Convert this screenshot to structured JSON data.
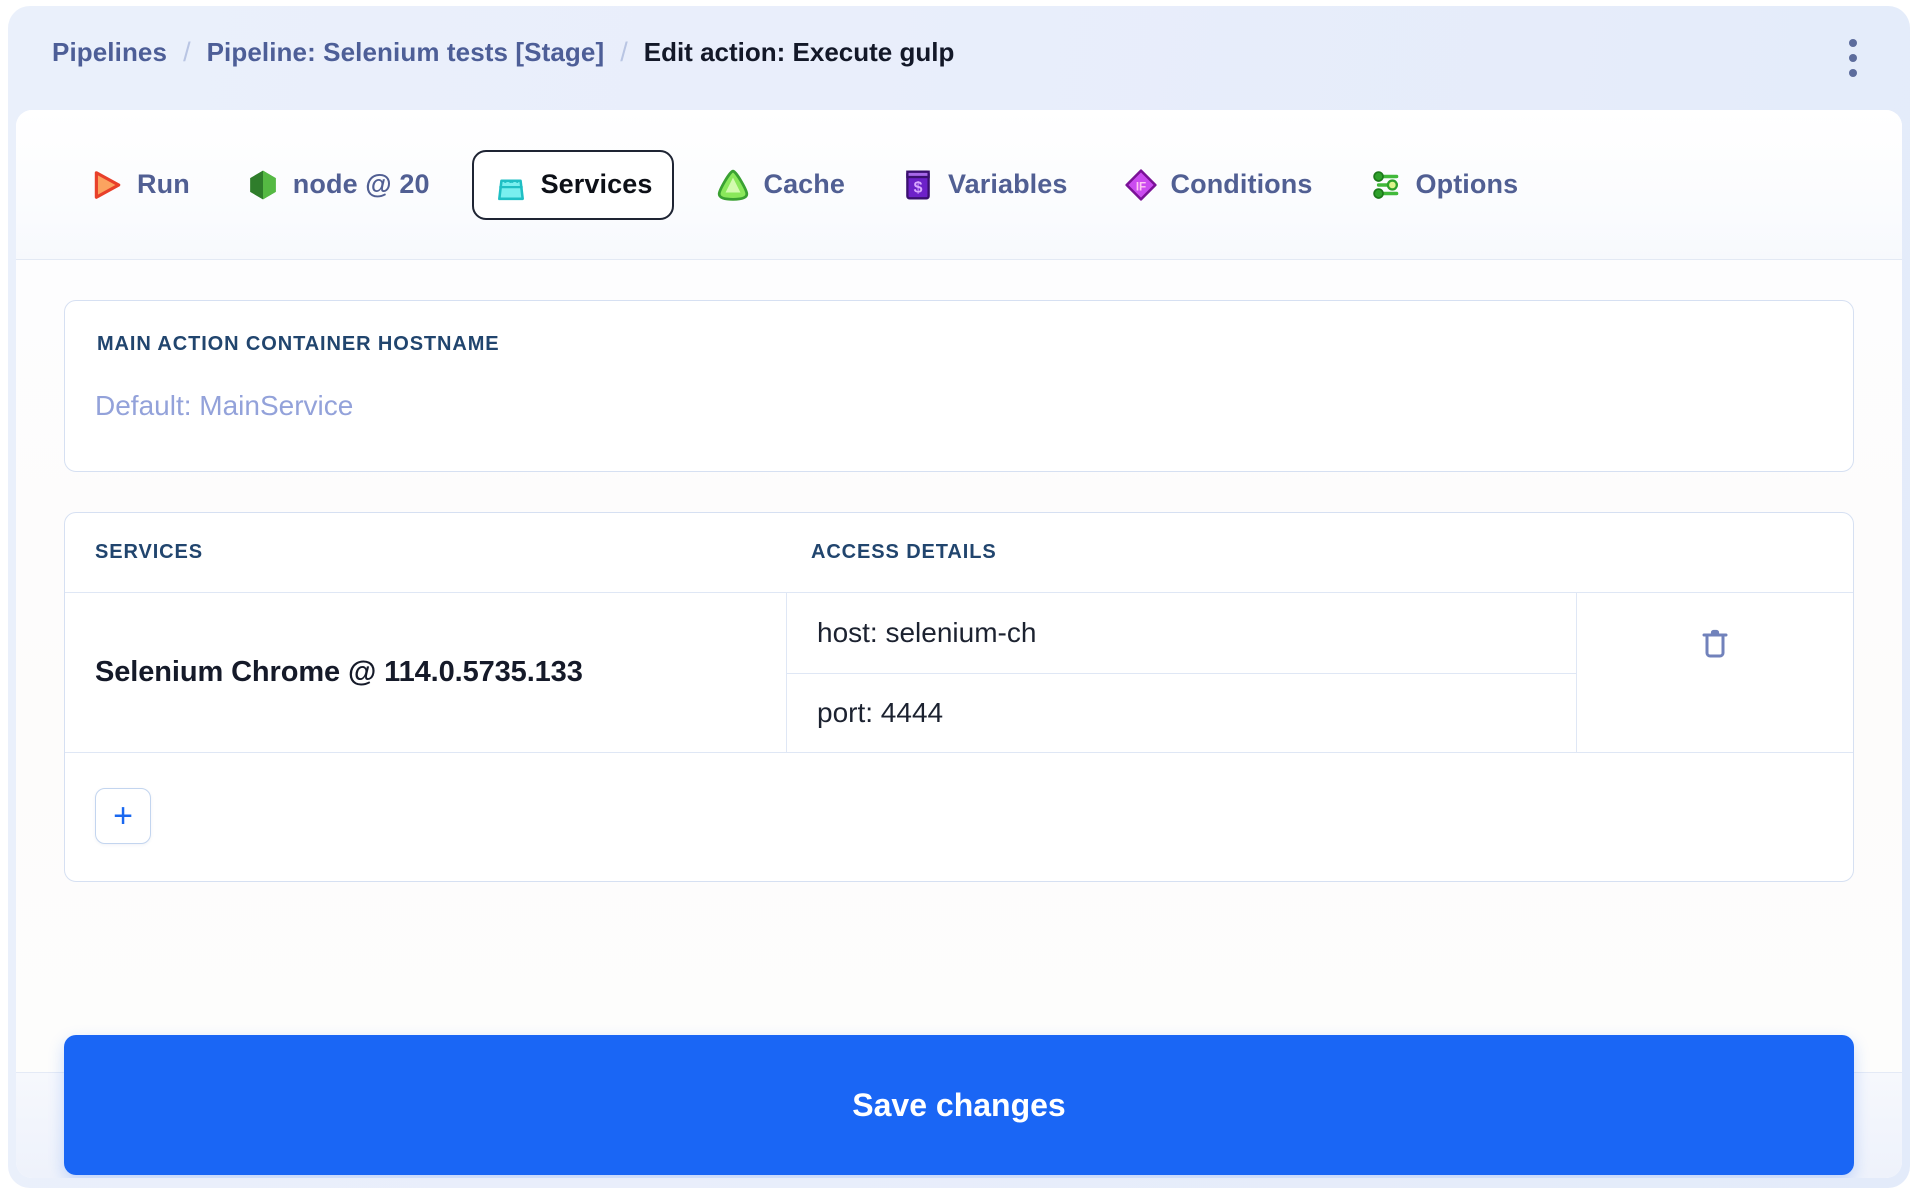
{
  "breadcrumb": {
    "root": "Pipelines",
    "separator": "/",
    "pipeline": "Pipeline: Selenium tests [Stage]",
    "current": "Edit action: Execute gulp"
  },
  "header": {
    "menu_label": "more-options"
  },
  "tabs": [
    {
      "label": "Run",
      "icon": "play-icon",
      "active": false
    },
    {
      "label": "node @ 20",
      "icon": "node-icon",
      "active": false
    },
    {
      "label": "Services",
      "icon": "services-icon",
      "active": true
    },
    {
      "label": "Cache",
      "icon": "cache-icon",
      "active": false
    },
    {
      "label": "Variables",
      "icon": "variables-icon",
      "active": false
    },
    {
      "label": "Conditions",
      "icon": "conditions-icon",
      "active": false
    },
    {
      "label": "Options",
      "icon": "options-icon",
      "active": false
    }
  ],
  "hostname_panel": {
    "label": "MAIN ACTION CONTAINER HOSTNAME",
    "value": "",
    "placeholder": "Default: MainService"
  },
  "services_table": {
    "columns": {
      "services": "SERVICES",
      "access_details": "ACCESS DETAILS"
    },
    "rows": [
      {
        "name": "Selenium Chrome @ 114.0.5735.133",
        "details": [
          "host: selenium-ch",
          "port: 4444"
        ],
        "delete_label": "trash-icon"
      }
    ],
    "add_label": "+"
  },
  "footer": {
    "save_label": "Save changes"
  },
  "colors": {
    "accent_blue": "#1a66f5",
    "breadcrumb_link": "#4d5e97",
    "breadcrumb_current": "#131828",
    "label_blue": "#21456e",
    "placeholder": "#93a2da",
    "border": "#d6e0f2",
    "header_bg": "#eaf0fb"
  }
}
